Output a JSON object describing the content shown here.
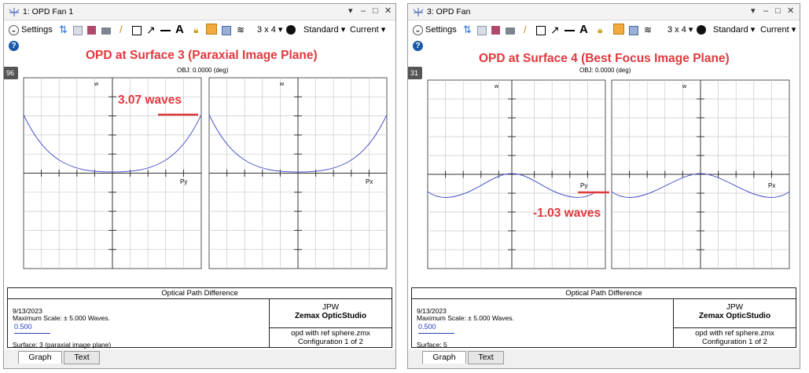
{
  "windows": [
    {
      "title": "1: OPD Fan 1",
      "toolbar": {
        "settings": "Settings",
        "layout": "3 x 4 ▾",
        "standard": "Standard ▾",
        "current": "Current ▾"
      },
      "badge": "96",
      "heading": "OPD at Surface 3 (Paraxial Image Plane)",
      "obj_label": "OBJ: 0.0000 (deg)",
      "plot_left": {
        "w_label": "w",
        "axis_label": "Py"
      },
      "plot_right": {
        "w_label": "w",
        "axis_label": "Px"
      },
      "annotation": "3.07 waves",
      "info": {
        "title": "Optical Path Difference",
        "date": "9/13/2023",
        "max_scale": "Maximum Scale: ± 5.000 Waves.",
        "scale_value": "0.500",
        "surface": "Surface: 3 (paraxial image plane)",
        "user": "JPW",
        "product": "Zemax OpticStudio",
        "file": "opd with ref sphere.zmx",
        "config": "Configuration 1 of 2"
      },
      "tabs": [
        "Graph",
        "Text"
      ]
    },
    {
      "title": "3: OPD Fan",
      "toolbar": {
        "settings": "Settings",
        "layout": "3 x 4 ▾",
        "standard": "Standard ▾",
        "current": "Current ▾"
      },
      "badge": "31",
      "heading": "OPD at Surface 4 (Best Focus Image Plane)",
      "obj_label": "OBJ: 0.0000 (deg)",
      "plot_left": {
        "w_label": "w",
        "axis_label": "Py"
      },
      "plot_right": {
        "w_label": "w",
        "axis_label": "Px"
      },
      "annotation": "-1.03 waves",
      "info": {
        "title": "Optical Path Difference",
        "date": "9/13/2023",
        "max_scale": "Maximum Scale: ± 5.000 Waves.",
        "scale_value": "0.500",
        "surface": "Surface: 5",
        "user": "JPW",
        "product": "Zemax OpticStudio",
        "file": "opd with ref sphere.zmx",
        "config": "Configuration 1 of 2"
      },
      "tabs": [
        "Graph",
        "Text"
      ]
    }
  ],
  "colors": {
    "curve": "#4a55c8",
    "annotation": "#e0393e",
    "selected_button": "#f3a93b",
    "help": "#1a5aa8"
  },
  "icons": [
    "opd-fan-icon",
    "dropdown-arrow-icon",
    "minimize-icon",
    "restore-icon",
    "close-icon",
    "settings-chevron-icon",
    "refresh-icon",
    "copy-icon",
    "save-icon",
    "print-icon",
    "pencil-icon",
    "rectangle-icon",
    "arrow-icon",
    "line-icon",
    "text-icon",
    "lock-icon",
    "grid-layout-icon",
    "window-icon",
    "layers-icon",
    "clock-icon",
    "help-icon"
  ]
}
